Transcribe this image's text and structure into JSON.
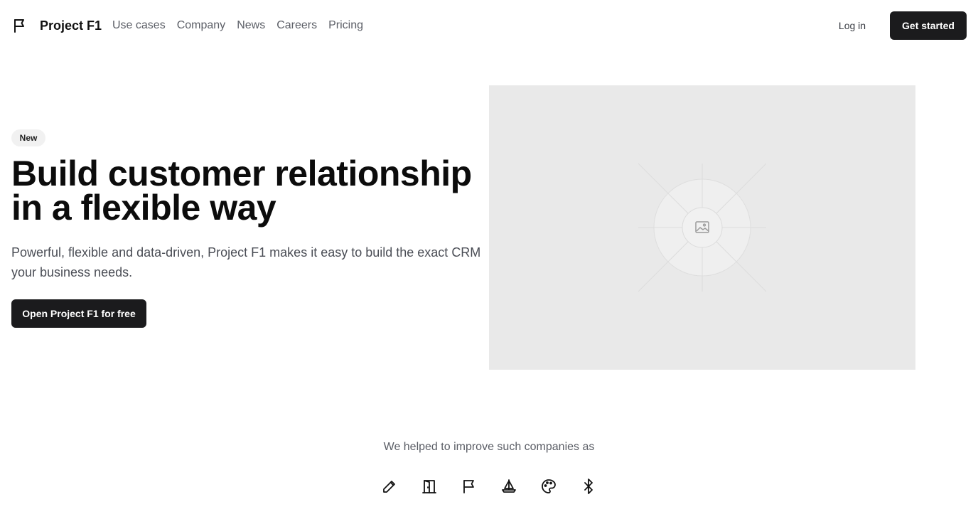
{
  "nav": {
    "brand": "Project F1",
    "brand_icon": "flag-icon",
    "links": [
      "Use cases",
      "Company",
      "News",
      "Careers",
      "Pricing"
    ],
    "login": "Log in",
    "cta": "Get started"
  },
  "hero": {
    "badge": "New",
    "title": "Build customer relationship in a flexible way",
    "description": "Powerful, flexible and data-driven, Project F1 makes it easy to build the exact CRM your business needs.",
    "cta": "Open Project F1 for free",
    "image_icon": "image-placeholder-icon"
  },
  "companies": {
    "label": "We helped to improve such companies as",
    "logos": [
      "pencil-icon",
      "door-icon",
      "flag-icon",
      "sailboat-icon",
      "palette-icon",
      "bluetooth-icon"
    ]
  },
  "colors": {
    "primary_button": "#1b1b1d",
    "muted_text": "#5b5e66",
    "image_bg": "#e9e9e9"
  }
}
